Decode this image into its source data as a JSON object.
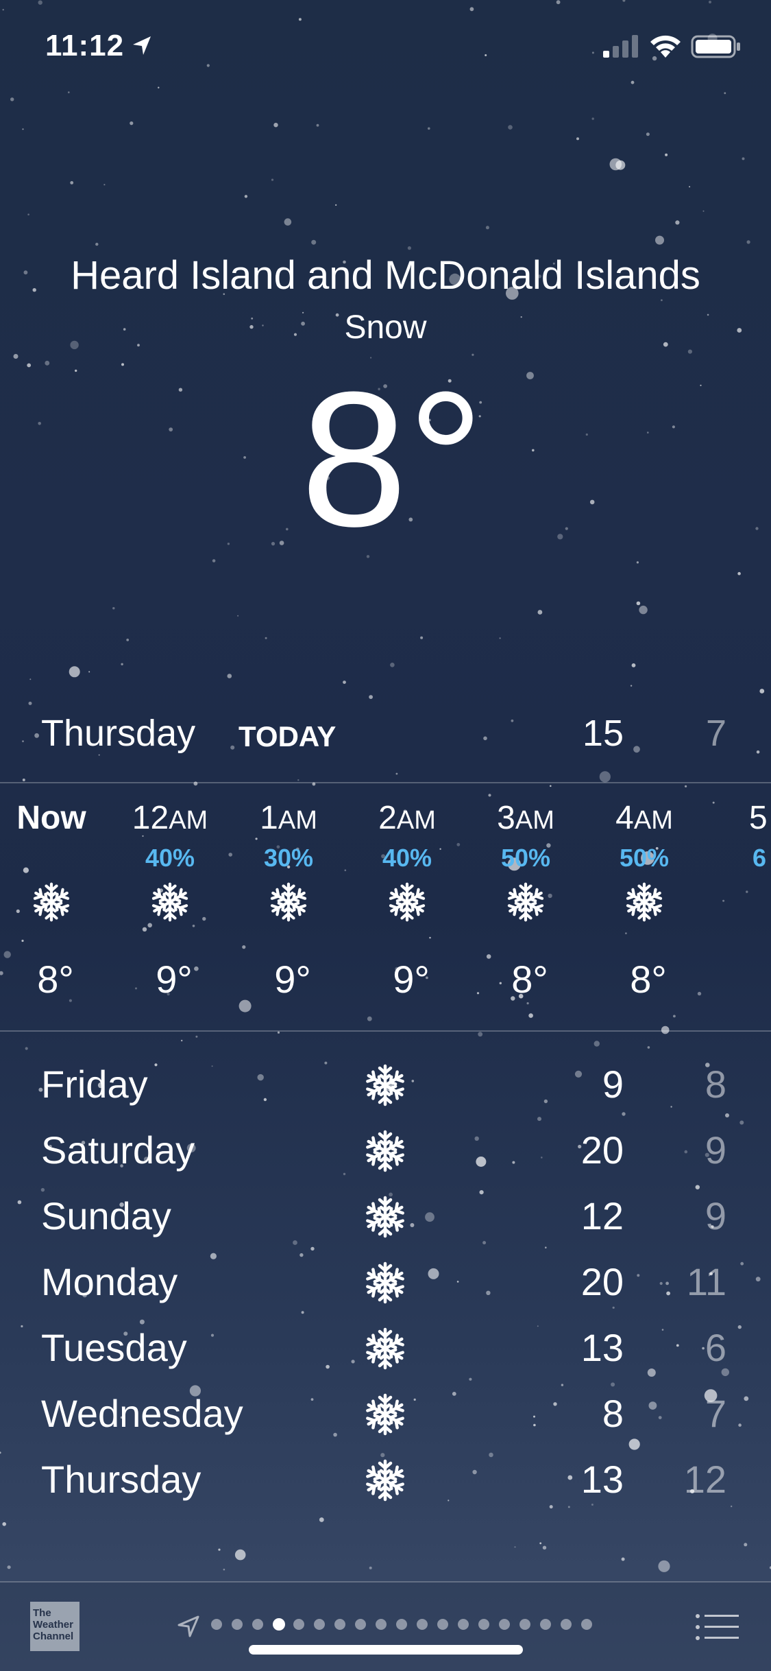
{
  "status_bar": {
    "time": "11:12",
    "icons": [
      "location-arrow-icon",
      "cellular-signal-icon",
      "wifi-icon",
      "battery-icon"
    ]
  },
  "location": {
    "name": "Heard Island and McDonald Islands",
    "condition": "Snow",
    "temperature": "8°"
  },
  "today": {
    "day": "Thursday",
    "label": "TODAY",
    "high": "15",
    "low": "7"
  },
  "hourly": [
    {
      "time": "Now",
      "pop": "",
      "icon": "snowflake-icon",
      "temp": "8°"
    },
    {
      "time": "12AM",
      "pop": "40%",
      "icon": "snowflake-icon",
      "temp": "9°"
    },
    {
      "time": "1AM",
      "pop": "30%",
      "icon": "snowflake-icon",
      "temp": "9°"
    },
    {
      "time": "2AM",
      "pop": "40%",
      "icon": "snowflake-icon",
      "temp": "9°"
    },
    {
      "time": "3AM",
      "pop": "50%",
      "icon": "snowflake-icon",
      "temp": "8°"
    },
    {
      "time": "4AM",
      "pop": "50%",
      "icon": "snowflake-icon",
      "temp": "8°"
    },
    {
      "time": "5",
      "pop": "6",
      "icon": "snowflake-icon",
      "temp": ""
    }
  ],
  "daily": [
    {
      "day": "Friday",
      "icon": "snowflake-icon",
      "high": "9",
      "low": "8"
    },
    {
      "day": "Saturday",
      "icon": "snowflake-icon",
      "high": "20",
      "low": "9"
    },
    {
      "day": "Sunday",
      "icon": "snowflake-icon",
      "high": "12",
      "low": "9"
    },
    {
      "day": "Monday",
      "icon": "snowflake-icon",
      "high": "20",
      "low": "11"
    },
    {
      "day": "Tuesday",
      "icon": "snowflake-icon",
      "high": "13",
      "low": "6"
    },
    {
      "day": "Wednesday",
      "icon": "snowflake-icon",
      "high": "8",
      "low": "7"
    },
    {
      "day": "Thursday",
      "icon": "snowflake-icon",
      "high": "13",
      "low": "12"
    }
  ],
  "toolbar": {
    "logo_lines": [
      "The",
      "Weather",
      "Channel"
    ],
    "page_count": 19,
    "active_page": 3
  },
  "colors": {
    "precip_blue": "#58b8f0",
    "low_temp": "rgba(255,255,255,0.5)"
  }
}
